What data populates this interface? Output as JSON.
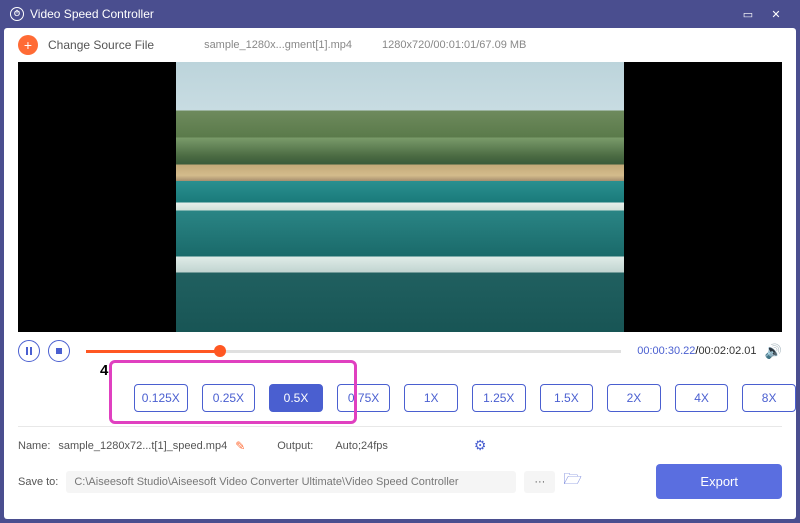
{
  "titlebar": {
    "title": "Video Speed Controller"
  },
  "toolbar": {
    "change_source": "Change Source File",
    "filename": "sample_1280x...gment[1].mp4",
    "info": "1280x720/00:01:01/67.09 MB"
  },
  "playback": {
    "current_time": "00:00:30.22",
    "duration": "00:02:02.01"
  },
  "annotation": {
    "number": "4"
  },
  "speeds": [
    "0.125X",
    "0.25X",
    "0.5X",
    "0.75X",
    "1X",
    "1.25X",
    "1.5X",
    "2X",
    "4X",
    "8X"
  ],
  "speed_active_index": 2,
  "output": {
    "name_label": "Name:",
    "name_value": "sample_1280x72...t[1]_speed.mp4",
    "output_label": "Output:",
    "output_value": "Auto;24fps",
    "save_label": "Save to:",
    "save_path": "C:\\Aiseesoft Studio\\Aiseesoft Video Converter Ultimate\\Video Speed Controller",
    "export": "Export"
  }
}
